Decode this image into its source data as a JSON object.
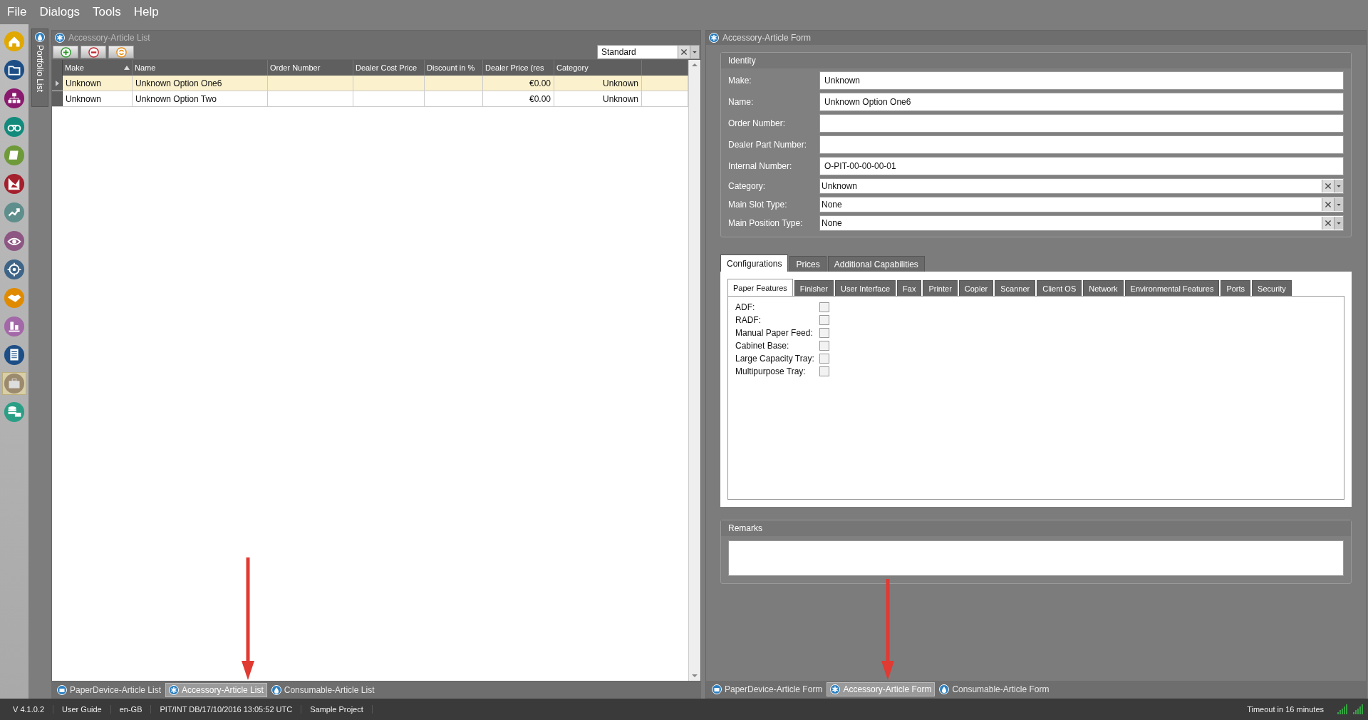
{
  "menu": [
    "File",
    "Dialogs",
    "Tools",
    "Help"
  ],
  "sidebar_buttons": [
    {
      "selected": false
    },
    {
      "selected": false
    },
    {
      "selected": false
    },
    {
      "selected": false
    },
    {
      "selected": false
    },
    {
      "selected": false
    },
    {
      "selected": false
    },
    {
      "selected": false
    },
    {
      "selected": false
    },
    {
      "selected": false
    },
    {
      "selected": false
    },
    {
      "selected": false
    },
    {
      "selected": true
    },
    {
      "selected": false
    }
  ],
  "portfolio_tab": {
    "label": "Portfolio List"
  },
  "list_panel": {
    "title": "Accessory-Article List",
    "view_select": {
      "value": "Standard"
    },
    "columns": [
      {
        "label": "Make",
        "sorted_ascending": true
      },
      {
        "label": "Name",
        "sorted_ascending": false
      },
      {
        "label": "Order Number",
        "sorted_ascending": false
      },
      {
        "label": "Dealer Cost Price",
        "sorted_ascending": false
      },
      {
        "label": "Discount in %",
        "sorted_ascending": false
      },
      {
        "label": "Dealer Price (res",
        "sorted_ascending": false
      },
      {
        "label": "Category",
        "sorted_ascending": false
      }
    ],
    "rows": [
      {
        "selected": true,
        "make": "Unknown",
        "name": "Unknown Option One6",
        "dealer_price": "€0.00",
        "category": "Unknown"
      },
      {
        "selected": false,
        "make": "Unknown",
        "name": "Unknown Option Two",
        "dealer_price": "€0.00",
        "category": "Unknown"
      }
    ],
    "tabs": [
      {
        "label": "PaperDevice-Article List",
        "selected": false
      },
      {
        "label": "Accessory-Article List",
        "selected": true
      },
      {
        "label": "Consumable-Article List",
        "selected": false
      }
    ]
  },
  "form_panel": {
    "title": "Accessory-Article Form",
    "identity": {
      "title": "Identity",
      "fields": [
        {
          "label": "Make:",
          "value": "Unknown",
          "kind": "text"
        },
        {
          "label": "Name:",
          "value": "Unknown Option One6",
          "kind": "text"
        },
        {
          "label": "Order Number:",
          "kind": "text"
        },
        {
          "label": "Dealer Part Number:",
          "kind": "text"
        },
        {
          "label": "Internal Number:",
          "value": "O-PIT-00-00-00-01",
          "kind": "text"
        },
        {
          "label": "Category:",
          "value": "Unknown",
          "kind": "combo"
        },
        {
          "label": "Main Slot Type:",
          "value": "None",
          "kind": "combo"
        },
        {
          "label": "Main Position Type:",
          "value": "None",
          "kind": "combo"
        }
      ]
    },
    "tabs": [
      {
        "label": "Configurations",
        "selected": true
      },
      {
        "label": "Prices",
        "selected": false
      },
      {
        "label": "Additional Capabilities",
        "selected": false
      }
    ],
    "subtabs": [
      {
        "label": "Paper Features",
        "selected": true
      },
      {
        "label": "Finisher",
        "selected": false
      },
      {
        "label": "User Interface",
        "selected": false
      },
      {
        "label": "Fax",
        "selected": false
      },
      {
        "label": "Printer",
        "selected": false
      },
      {
        "label": "Copier",
        "selected": false
      },
      {
        "label": "Scanner",
        "selected": false
      },
      {
        "label": "Client OS",
        "selected": false
      },
      {
        "label": "Network",
        "selected": false
      },
      {
        "label": "Environmental Features",
        "selected": false
      },
      {
        "label": "Ports",
        "selected": false
      },
      {
        "label": "Security",
        "selected": false
      }
    ],
    "checkboxes": [
      {
        "label": "ADF:",
        "checked": false
      },
      {
        "label": "RADF:",
        "checked": false
      },
      {
        "label": "Manual Paper Feed:",
        "checked": false
      },
      {
        "label": "Cabinet Base:",
        "checked": false
      },
      {
        "label": "Large Capacity Tray:",
        "checked": false
      },
      {
        "label": "Multipurpose Tray:",
        "checked": false
      }
    ],
    "remarks": {
      "title": "Remarks"
    },
    "tabs_bottom": [
      {
        "label": "PaperDevice-Article Form",
        "selected": false
      },
      {
        "label": "Accessory-Article Form",
        "selected": true
      },
      {
        "label": "Consumable-Article Form",
        "selected": false
      }
    ]
  },
  "status_bar": {
    "items": [
      "V 4.1.0.2",
      "User Guide",
      "en-GB",
      "PIT/INT DB/17/10/2016 13:05:52 UTC",
      "Sample Project"
    ],
    "timeout": "Timeout in 16 minutes"
  }
}
